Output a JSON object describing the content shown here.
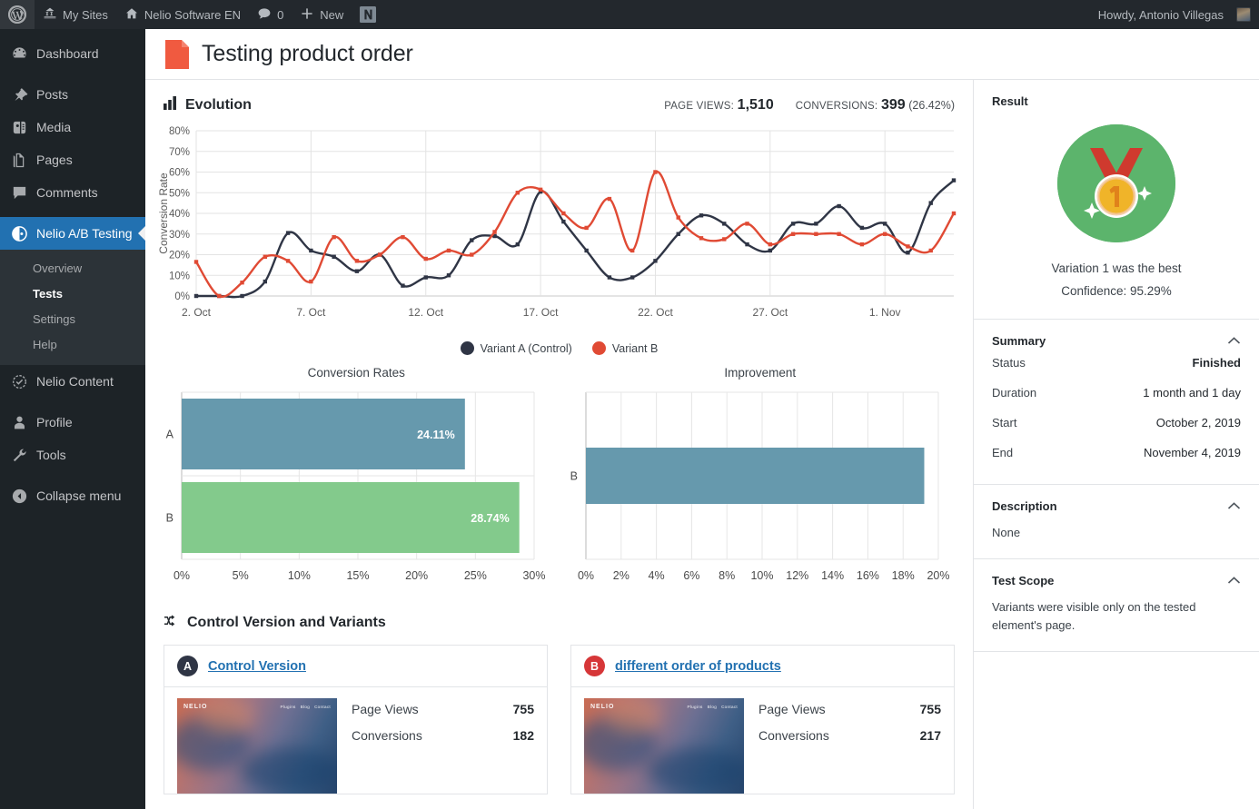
{
  "adminbar": {
    "wp_logo": "wordpress-logo-icon",
    "items": [
      {
        "label": "My Sites",
        "icon": "sites-icon"
      },
      {
        "label": "Nelio Software EN",
        "icon": "home-icon"
      },
      {
        "label": "0",
        "icon": "comment-icon"
      },
      {
        "label": "New",
        "icon": "plus-icon"
      }
    ],
    "nelio_icon": "nelio-logo-icon",
    "howdy": "Howdy, Antonio Villegas",
    "avatar": "user-avatar"
  },
  "adminmenu": {
    "items": [
      {
        "label": "Dashboard",
        "icon": "dashboard-icon"
      },
      {
        "label": "Posts",
        "icon": "pin-icon"
      },
      {
        "label": "Media",
        "icon": "media-icon"
      },
      {
        "label": "Pages",
        "icon": "pages-icon"
      },
      {
        "label": "Comments",
        "icon": "comments-icon"
      },
      {
        "label": "Nelio A/B Testing",
        "icon": "nelio-ab-icon",
        "current": true
      }
    ],
    "submenu": [
      {
        "label": "Overview"
      },
      {
        "label": "Tests",
        "current": true
      },
      {
        "label": "Settings"
      },
      {
        "label": "Help"
      }
    ],
    "items2": [
      {
        "label": "Nelio Content",
        "icon": "nelio-content-icon"
      },
      {
        "label": "Profile",
        "icon": "profile-icon"
      },
      {
        "label": "Tools",
        "icon": "tools-icon"
      }
    ],
    "collapse": {
      "label": "Collapse menu",
      "icon": "collapse-arrow-icon"
    }
  },
  "page": {
    "title": "Testing product order",
    "title_icon": "page-doc-icon"
  },
  "evolution": {
    "heading": "Evolution",
    "heading_icon": "bar-chart-icon",
    "page_views_label": "PAGE VIEWS:",
    "page_views_value": "1,510",
    "conversions_label": "CONVERSIONS:",
    "conversions_value": "399",
    "conversions_pct": "(26.42%)"
  },
  "chart_data": [
    {
      "type": "line",
      "title": "Evolution",
      "xlabel": "",
      "ylabel": "Conversion Rate",
      "ylim": [
        0,
        80
      ],
      "yticks": [
        "0%",
        "10%",
        "20%",
        "30%",
        "40%",
        "50%",
        "60%",
        "70%",
        "80%"
      ],
      "xticks": [
        "2. Oct",
        "7. Oct",
        "12. Oct",
        "17. Oct",
        "22. Oct",
        "27. Oct",
        "1. Nov"
      ],
      "xtick_indices": [
        0,
        5,
        10,
        15,
        20,
        25,
        30
      ],
      "grid": true,
      "legend_position": "bottom",
      "x": [
        "2. Oct",
        "3. Oct",
        "4. Oct",
        "5. Oct",
        "6. Oct",
        "7. Oct",
        "8. Oct",
        "9. Oct",
        "10. Oct",
        "11. Oct",
        "12. Oct",
        "13. Oct",
        "14. Oct",
        "15. Oct",
        "16. Oct",
        "17. Oct",
        "18. Oct",
        "19. Oct",
        "20. Oct",
        "21. Oct",
        "22. Oct",
        "23. Oct",
        "24. Oct",
        "25. Oct",
        "26. Oct",
        "27. Oct",
        "28. Oct",
        "29. Oct",
        "30. Oct",
        "31. Oct",
        "1. Nov",
        "2. Nov",
        "3. Nov",
        "4. Nov"
      ],
      "series": [
        {
          "name": "Variant A (Control)",
          "color": "#2f3545",
          "values": [
            0,
            0,
            0,
            7,
            30.5,
            22,
            19,
            12,
            20,
            5,
            9,
            10,
            27,
            29,
            25,
            50.5,
            36,
            22,
            9,
            9,
            17,
            30,
            39,
            35,
            25,
            22,
            35,
            35,
            43.5,
            33,
            35,
            21,
            45,
            56
          ]
        },
        {
          "name": "Variant B",
          "color": "#e04a34",
          "values": [
            16.5,
            0,
            6.5,
            19,
            17,
            7,
            28.5,
            17,
            20,
            28.5,
            18,
            22,
            20,
            31,
            50,
            51.5,
            40,
            33,
            47,
            22,
            60,
            38,
            28,
            27.5,
            35,
            25,
            30,
            30,
            30,
            25,
            30,
            24,
            22,
            40
          ]
        }
      ]
    },
    {
      "type": "bar",
      "orientation": "horizontal",
      "title": "Conversion Rates",
      "categories": [
        "A",
        "B"
      ],
      "values": [
        24.11,
        28.74
      ],
      "value_labels": [
        "24.11%",
        "28.74%"
      ],
      "colors": [
        "#6699ad",
        "#83ca8c"
      ],
      "xlim": [
        0,
        30
      ],
      "xticks": [
        "0%",
        "5%",
        "10%",
        "15%",
        "20%",
        "25%",
        "30%"
      ],
      "grid": true
    },
    {
      "type": "bar",
      "orientation": "horizontal",
      "title": "Improvement",
      "categories": [
        "B"
      ],
      "values": [
        19.2
      ],
      "value_labels": [
        ""
      ],
      "colors": [
        "#6699ad"
      ],
      "xlim": [
        0,
        20
      ],
      "xticks": [
        "0%",
        "2%",
        "4%",
        "6%",
        "8%",
        "10%",
        "12%",
        "14%",
        "16%",
        "18%",
        "20%"
      ],
      "grid": true
    }
  ],
  "variants_section": {
    "heading": "Control Version and Variants",
    "heading_icon": "shuffle-icon",
    "cards": [
      {
        "badge": "A",
        "badge_color": "#2f3545",
        "link": "Control Version",
        "thumb": {
          "logo": "NELIO",
          "nav": [
            "Plugins",
            "Blog",
            "Contact"
          ]
        },
        "stats": [
          {
            "label": "Page Views",
            "value": "755"
          },
          {
            "label": "Conversions",
            "value": "182"
          }
        ]
      },
      {
        "badge": "B",
        "badge_color": "#d63638",
        "link": "different order of products",
        "thumb": {
          "logo": "NELIO",
          "nav": [
            "Plugins",
            "Blog",
            "Contact"
          ]
        },
        "stats": [
          {
            "label": "Page Views",
            "value": "755"
          },
          {
            "label": "Conversions",
            "value": "217"
          }
        ]
      }
    ]
  },
  "sidebar": {
    "result": {
      "heading": "Result",
      "icon": "medal-winner-icon",
      "caption": "Variation 1 was the best",
      "confidence": "Confidence: 95.29%"
    },
    "summary": {
      "heading": "Summary",
      "toggle_icon": "chevron-up-icon",
      "rows": [
        {
          "key": "Status",
          "value": "Finished",
          "bold": true
        },
        {
          "key": "Duration",
          "value": "1 month and 1 day",
          "bold": false
        },
        {
          "key": "Start",
          "value": "October 2, 2019",
          "bold": false
        },
        {
          "key": "End",
          "value": "November 4, 2019",
          "bold": false
        }
      ]
    },
    "description": {
      "heading": "Description",
      "toggle_icon": "chevron-up-icon",
      "text": "None"
    },
    "scope": {
      "heading": "Test Scope",
      "toggle_icon": "chevron-up-icon",
      "text": "Variants were visible only on the tested element's page."
    }
  }
}
